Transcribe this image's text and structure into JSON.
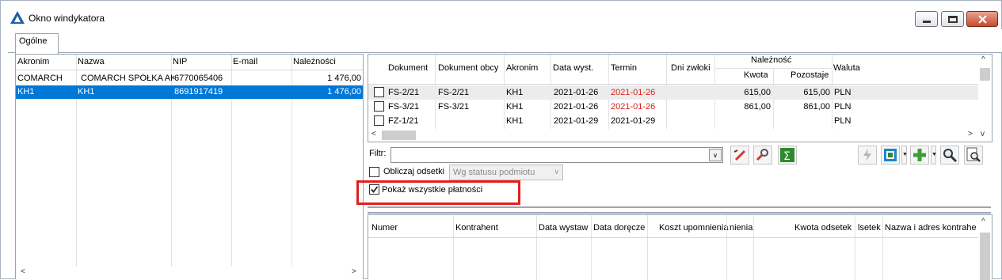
{
  "window": {
    "title": "Okno windykatora"
  },
  "tabs": [
    {
      "label": "Ogólne"
    }
  ],
  "left_table": {
    "columns": [
      "Akronim",
      "Nazwa",
      "NIP",
      "E-mail",
      "Należności"
    ],
    "rows": [
      {
        "akronim": "COMARCH",
        "nazwa": "COMARCH  SPÓŁKA AKC",
        "nip": "6770065406",
        "email": "",
        "naleznosci": "1 476,00",
        "selected": false
      },
      {
        "akronim": "KH1",
        "nazwa": "KH1",
        "nip": "8691917419",
        "email": "",
        "naleznosci": "1 476,00",
        "selected": true
      }
    ]
  },
  "docs_table": {
    "columns": {
      "dokument": "Dokument",
      "dokument_obcy": "Dokument obcy",
      "akronim": "Akronim",
      "data_wyst": "Data wyst.",
      "termin": "Termin",
      "dni_zwloki": "Dni zwłoki",
      "naleznosc": "Należność",
      "kwota": "Kwota",
      "pozostaje": "Pozostaje",
      "waluta": "Waluta"
    },
    "rows": [
      {
        "dokument": "FS-2/21",
        "dokument_obcy": "FS-2/21",
        "akronim": "KH1",
        "data_wyst": "2021-01-26",
        "termin": "2021-01-26",
        "termin_overdue": true,
        "dni_zwloki": "",
        "kwota": "615,00",
        "pozostaje": "615,00",
        "waluta": "PLN"
      },
      {
        "dokument": "FS-3/21",
        "dokument_obcy": "FS-3/21",
        "akronim": "KH1",
        "data_wyst": "2021-01-26",
        "termin": "2021-01-26",
        "termin_overdue": true,
        "dni_zwloki": "",
        "kwota": "861,00",
        "pozostaje": "861,00",
        "waluta": "PLN"
      },
      {
        "dokument": "FZ-1/21",
        "dokument_obcy": "",
        "akronim": "KH1",
        "data_wyst": "2021-01-29",
        "termin": "2021-01-29",
        "termin_overdue": false,
        "dni_zwloki": "",
        "kwota": "",
        "pozostaje": "",
        "waluta": "PLN"
      }
    ]
  },
  "filter": {
    "label": "Filtr:",
    "value": ""
  },
  "options": {
    "interest_label": "Obliczaj odsetki",
    "interest_checked": false,
    "interest_mode": "Wg statusu podmiotu",
    "show_all_label": "Pokaż wszystkie płatności",
    "show_all_checked": true
  },
  "reminders_table": {
    "columns": [
      "Numer",
      "Kontrahent",
      "Data wystaw",
      "Data doręcze",
      "Koszt upomnienia",
      "nienia",
      "Kwota odsetek",
      "lsetek",
      "Nazwa i adres kontrahe"
    ]
  },
  "colors": {
    "selection": "#0078d7",
    "overdue": "#e0201c",
    "highlight": "#e0201c"
  },
  "icons": [
    "app-logo-icon",
    "minimize-icon",
    "maximize-icon",
    "close-icon",
    "clear-filter-icon",
    "filter-builder-icon",
    "sum-icon",
    "lightning-icon",
    "generate-icon",
    "add-icon",
    "search-icon",
    "preview-icon"
  ]
}
